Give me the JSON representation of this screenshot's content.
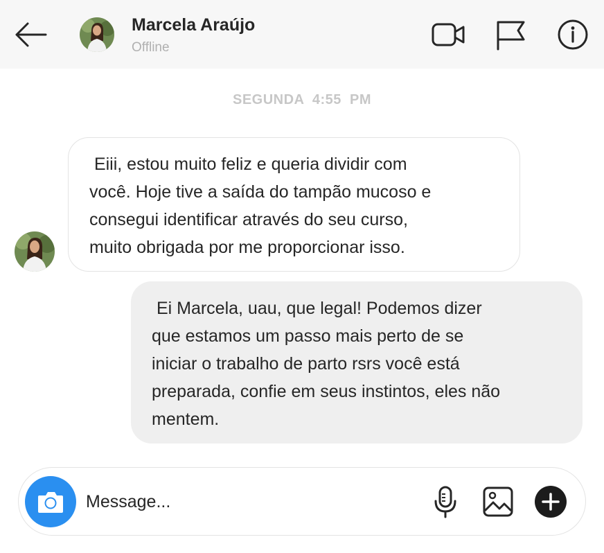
{
  "header": {
    "contact_name": "Marcela Araújo",
    "status": "Offline",
    "icons": [
      "back-arrow-icon",
      "video-call-icon",
      "flag-icon",
      "info-icon"
    ]
  },
  "timestamp": "SEGUNDA  4:55  PM",
  "messages": [
    {
      "direction": "incoming",
      "text": " Eiii, estou muito feliz e queria dividir com\nvocê. Hoje tive a saída do tampão mucoso e\nconsegui identificar através do seu curso,\nmuito obrigada por me proporcionar isso."
    },
    {
      "direction": "outgoing",
      "text": " Ei Marcela, uau, que legal! Podemos dizer\nque estamos um passo mais perto de se\niniciar o trabalho de parto rsrs você está\npreparada, confie em seus instintos, eles não\nmentem."
    }
  ],
  "composer": {
    "placeholder": "Message...",
    "value": "",
    "icons": [
      "camera-icon",
      "microphone-icon",
      "gallery-icon",
      "plus-icon"
    ]
  },
  "colors": {
    "header_bg": "#f7f7f7",
    "camera_button": "#2a8ff0",
    "outgoing_bubble": "#efefef",
    "incoming_border": "#e3e3e3",
    "timestamp_text": "#c7c7c7",
    "status_text": "#b0b0b0"
  }
}
